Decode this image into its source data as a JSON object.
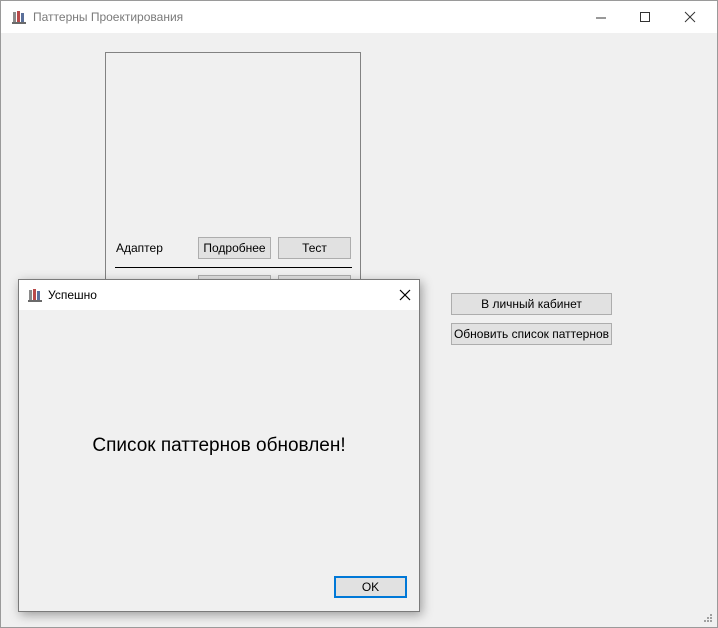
{
  "window": {
    "title": "Паттерны Проектирования"
  },
  "pattern_list": {
    "items": [
      {
        "name": "Адаптер",
        "details_label": "Подробнее",
        "test_label": "Тест"
      }
    ]
  },
  "side_buttons": {
    "cabinet_label": "В личный кабинет",
    "refresh_label": "Обновить список паттернов"
  },
  "dialog": {
    "title": "Успешно",
    "message": "Список паттернов обновлен!",
    "ok_label": "OK"
  },
  "icons": {
    "app": "app-icon",
    "minimize": "minimize-icon",
    "maximize": "maximize-icon",
    "close": "close-icon"
  },
  "colors": {
    "accent": "#0078d7",
    "window_bg": "#f0f0f0",
    "titlebar_bg": "#ffffff"
  }
}
